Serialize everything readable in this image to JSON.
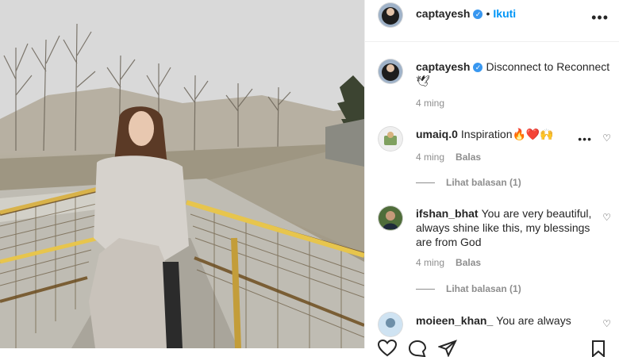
{
  "post": {
    "username": "captayesh",
    "follow_label": "Ikuti",
    "more_label": "•••"
  },
  "caption": {
    "username": "captayesh",
    "text": "Disconnect to Reconnect 🕊",
    "time": "4 ming"
  },
  "comments": [
    {
      "username": "umaiq.0",
      "text": "Inspiration🔥❤️🙌",
      "time": "4 ming",
      "reply_label": "Balas",
      "replies_label": "Lihat balasan (1)"
    },
    {
      "username": "ifshan_bhat",
      "text": "You are very beautiful, always shine like this, my blessings are from God",
      "time": "4 ming",
      "reply_label": "Balas",
      "replies_label": "Lihat balasan (1)"
    },
    {
      "username": "moieen_khan_",
      "text": "You are always"
    }
  ],
  "icons": {
    "verified": "verified-badge-icon",
    "like": "heart-icon",
    "comment": "comment-icon",
    "share": "share-icon",
    "save": "bookmark-icon"
  },
  "colors": {
    "accent": "#0095f6",
    "verified": "#3897f0",
    "muted": "#8e8e8e",
    "text": "#262626"
  }
}
